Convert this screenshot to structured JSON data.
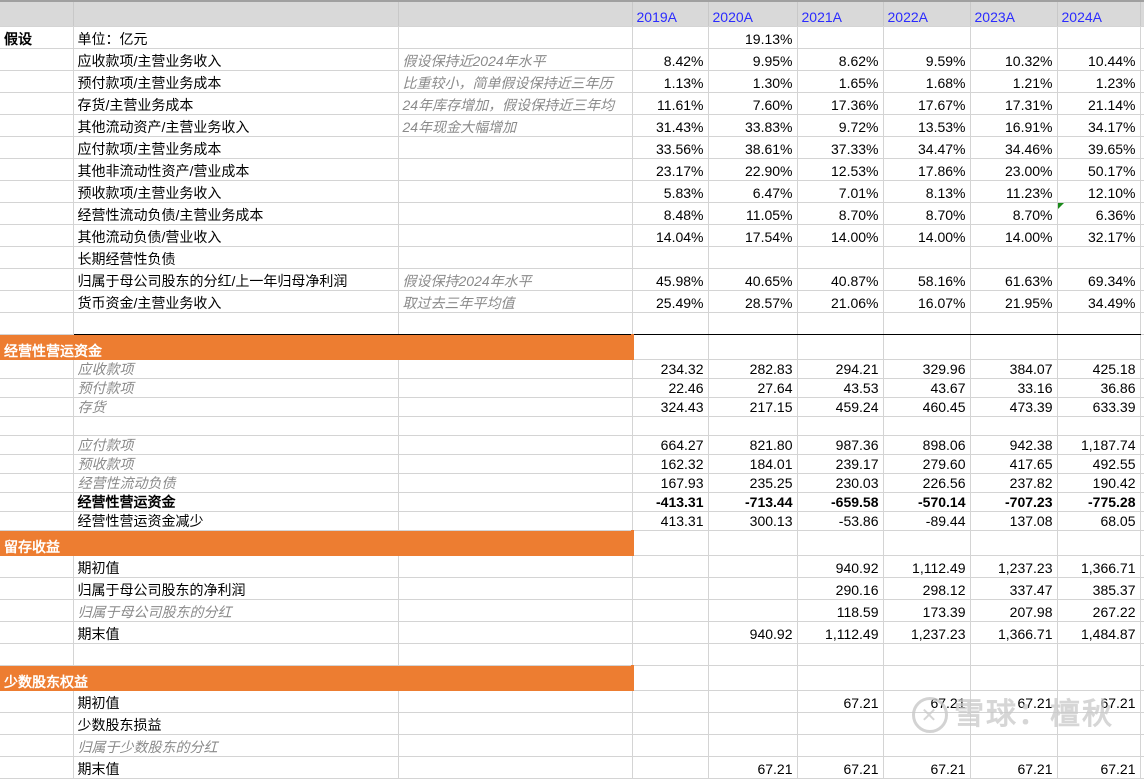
{
  "years": [
    "2019A",
    "2020A",
    "2021A",
    "2022A",
    "2023A",
    "2024A"
  ],
  "accent_color": "#ed7d31",
  "watermark": "雪球：檀秋",
  "rows": [
    {
      "kind": "r21",
      "a": "假设",
      "a_bold": true,
      "label": "单位：亿元",
      "note": "",
      "values": [
        "",
        "19.13%",
        "",
        "",
        "",
        ""
      ]
    },
    {
      "kind": "r21",
      "label": "应收款项/主营业务收入",
      "note": "假设保持近2024年水平",
      "values": [
        "8.42%",
        "9.95%",
        "8.62%",
        "9.59%",
        "10.32%",
        "10.44%"
      ]
    },
    {
      "kind": "r21",
      "label": "预付款项/主营业务成本",
      "note": "比重较小，简单假设保持近三年历",
      "values": [
        "1.13%",
        "1.30%",
        "1.65%",
        "1.68%",
        "1.21%",
        "1.23%"
      ]
    },
    {
      "kind": "r21",
      "label": "存货/主营业务成本",
      "note": "24年库存增加，假设保持近三年均",
      "values": [
        "11.61%",
        "7.60%",
        "17.36%",
        "17.67%",
        "17.31%",
        "21.14%"
      ]
    },
    {
      "kind": "r21",
      "label": "其他流动资产/主营业务收入",
      "note": "24年现金大幅增加",
      "values": [
        "31.43%",
        "33.83%",
        "9.72%",
        "13.53%",
        "16.91%",
        "34.17%"
      ]
    },
    {
      "kind": "r21",
      "label": "应付款项/主营业务成本",
      "note": "",
      "values": [
        "33.56%",
        "38.61%",
        "37.33%",
        "34.47%",
        "34.46%",
        "39.65%"
      ]
    },
    {
      "kind": "r21",
      "label": "其他非流动性资产/营业成本",
      "note": "",
      "values": [
        "23.17%",
        "22.90%",
        "12.53%",
        "17.86%",
        "23.00%",
        "50.17%"
      ]
    },
    {
      "kind": "r21",
      "label": "预收款项/主营业务收入",
      "note": "",
      "values": [
        "5.83%",
        "6.47%",
        "7.01%",
        "8.13%",
        "11.23%",
        "12.10%"
      ]
    },
    {
      "kind": "r21",
      "label": "经营性流动负债/主营业务成本",
      "note": "",
      "values": [
        "8.48%",
        "11.05%",
        "8.70%",
        "8.70%",
        "8.70%",
        "6.36%"
      ],
      "flag": true
    },
    {
      "kind": "r21",
      "label": "其他流动负债/营业收入",
      "note": "",
      "values": [
        "14.04%",
        "17.54%",
        "14.00%",
        "14.00%",
        "14.00%",
        "32.17%"
      ]
    },
    {
      "kind": "r21",
      "label": "长期经营性负债",
      "note": "",
      "values": [
        "",
        "",
        "",
        "",
        "",
        ""
      ]
    },
    {
      "kind": "r21",
      "label": "归属于母公司股东的分红/上一年归母净利润",
      "note": "假设保持2024年水平",
      "values": [
        "45.98%",
        "40.65%",
        "40.87%",
        "58.16%",
        "61.63%",
        "69.34%"
      ]
    },
    {
      "kind": "r21",
      "label": "货币资金/主营业务收入",
      "note": "取过去三年平均值",
      "values": [
        "25.49%",
        "28.57%",
        "21.06%",
        "16.07%",
        "21.95%",
        "34.49%"
      ]
    },
    {
      "kind": "r21",
      "thick": true,
      "label": "",
      "note": "",
      "values": [
        "",
        "",
        "",
        "",
        "",
        ""
      ]
    },
    {
      "kind": "sec",
      "section": "经营性营运资金"
    },
    {
      "kind": "r18",
      "label": "应收款项",
      "style": "it",
      "values": [
        "234.32",
        "282.83",
        "294.21",
        "329.96",
        "384.07",
        "425.18"
      ]
    },
    {
      "kind": "r18",
      "label": "预付款项",
      "style": "it",
      "values": [
        "22.46",
        "27.64",
        "43.53",
        "43.67",
        "33.16",
        "36.86"
      ]
    },
    {
      "kind": "r18",
      "label": "存货",
      "style": "it",
      "values": [
        "324.43",
        "217.15",
        "459.24",
        "460.45",
        "473.39",
        "633.39"
      ]
    },
    {
      "kind": "r18",
      "label": "",
      "values": [
        "",
        "",
        "",
        "",
        "",
        ""
      ]
    },
    {
      "kind": "r18",
      "label": "应付款项",
      "style": "it",
      "values": [
        "664.27",
        "821.80",
        "987.36",
        "898.06",
        "942.38",
        "1,187.74"
      ]
    },
    {
      "kind": "r18",
      "label": "预收款项",
      "style": "it",
      "values": [
        "162.32",
        "184.01",
        "239.17",
        "279.60",
        "417.65",
        "492.55"
      ]
    },
    {
      "kind": "r18",
      "label": "经营性流动负债",
      "style": "it",
      "values": [
        "167.93",
        "235.25",
        "230.03",
        "226.56",
        "237.82",
        "190.42"
      ]
    },
    {
      "kind": "r18",
      "label": "经营性营运资金",
      "style": "bold",
      "values": [
        "-413.31",
        "-713.44",
        "-659.58",
        "-570.14",
        "-707.23",
        "-775.28"
      ]
    },
    {
      "kind": "r18",
      "label": "经营性营运资金减少",
      "values": [
        "413.31",
        "300.13",
        "-53.86",
        "-89.44",
        "137.08",
        "68.05"
      ]
    },
    {
      "kind": "sec",
      "section": "留存收益"
    },
    {
      "kind": "r21",
      "label": "期初值",
      "values": [
        "",
        "",
        "940.92",
        "1,112.49",
        "1,237.23",
        "1,366.71"
      ]
    },
    {
      "kind": "r21",
      "label": "归属于母公司股东的净利润",
      "values": [
        "",
        "",
        "290.16",
        "298.12",
        "337.47",
        "385.37"
      ]
    },
    {
      "kind": "r21",
      "label": "归属于母公司股东的分红",
      "style": "it",
      "values": [
        "",
        "",
        "118.59",
        "173.39",
        "207.98",
        "267.22"
      ]
    },
    {
      "kind": "r21",
      "label": "期末值",
      "values": [
        "",
        "940.92",
        "1,112.49",
        "1,237.23",
        "1,366.71",
        "1,484.87"
      ]
    },
    {
      "kind": "r21",
      "label": "",
      "values": [
        "",
        "",
        "",
        "",
        "",
        ""
      ]
    },
    {
      "kind": "sec",
      "section": "少数股东权益"
    },
    {
      "kind": "r21",
      "label": "期初值",
      "values": [
        "",
        "",
        "67.21",
        "67.21",
        "67.21",
        "67.21"
      ]
    },
    {
      "kind": "r21",
      "label": "少数股东损益",
      "values": [
        "",
        "",
        "",
        "",
        "",
        ""
      ]
    },
    {
      "kind": "r21",
      "label": "归属于少数股东的分红",
      "style": "it",
      "values": [
        "",
        "",
        "",
        "",
        "",
        ""
      ]
    },
    {
      "kind": "r21",
      "label": "期末值",
      "values": [
        "",
        "67.21",
        "67.21",
        "67.21",
        "67.21",
        "67.21"
      ]
    }
  ]
}
